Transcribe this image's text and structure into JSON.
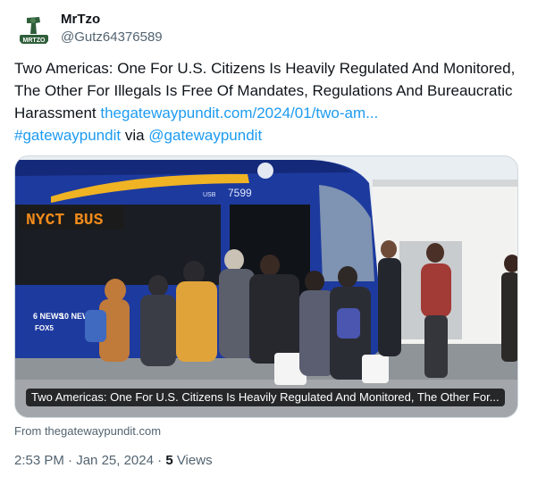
{
  "author": {
    "display_name": "MrTzo",
    "handle": "@Gutz64376589",
    "avatar_text": "MRTZO"
  },
  "tweet": {
    "text": "Two Americas: One For U.S. Citizens Is Heavily Regulated And Monitored, The Other For Illegals Is Free Of Mandates, Regulations And Bureaucratic Harassment ",
    "link_text": "thegatewaypundit.com/2024/01/two-am...",
    "hashtag": "#gatewaypundit",
    "via_text": " via ",
    "mention": "@gatewaypundit"
  },
  "card": {
    "caption": "Two Americas: One For U.S. Citizens Is Heavily Regulated And Monitored, The Other For...",
    "source": "From thegatewaypundit.com",
    "bus_sign": "NYCT BUS",
    "bus_number": "7599",
    "bus_label": "USB",
    "logo_news6": "6 NEWS",
    "logo_news10": "10 NEWS",
    "logo_fox": "FOX5"
  },
  "meta": {
    "time": "2:53 PM",
    "sep1": " · ",
    "date": "Jan 25, 2024",
    "sep2": " · ",
    "views_count": "5",
    "views_label": " Views"
  },
  "colors": {
    "link": "#1d9bf0",
    "bus_blue": "#1d3a9e",
    "bus_sign": "#f28a1a"
  }
}
